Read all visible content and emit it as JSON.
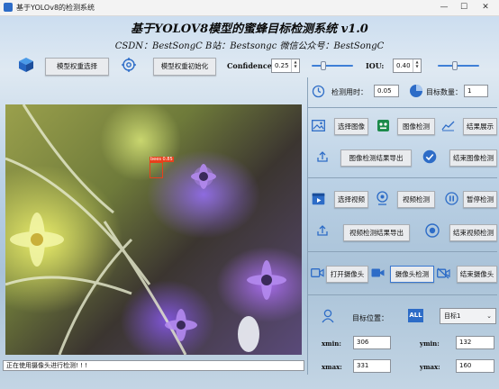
{
  "window": {
    "title": "基于YOLOv8的检测系统",
    "minimize": "—",
    "maximize": "☐",
    "close": "✕"
  },
  "header": {
    "title": "基于YOLOV8模型的蜜蜂目标检测系统 v1.0",
    "subtitle": "CSDN：BestSongC   B站：Bestsongc   微信公众号：BestSongC"
  },
  "toolbar": {
    "select_weights": "模型权重选择",
    "init_weights": "模型权重初始化",
    "confidence_label": "Confidence:",
    "confidence_value": "0.25",
    "confidence_level": 0.25,
    "iou_label": "IOU:",
    "iou_value": "0.40",
    "iou_level": 0.4
  },
  "stats": {
    "time_label": "检测用时：",
    "time_value": "0.05",
    "count_label": "目标数量：",
    "count_value": "1"
  },
  "image_section": {
    "select": "选择图像",
    "detect": "图像检测",
    "show": "结果展示",
    "export": "图像检测结果导出",
    "stop": "结束图像检测"
  },
  "video_section": {
    "select": "选择视频",
    "detect": "视频检测",
    "pause": "暂停检测",
    "export": "视频检测结果导出",
    "stop": "结束视频检测"
  },
  "camera_section": {
    "open": "打开摄像头",
    "detect": "摄像头检测",
    "close": "结束摄像头"
  },
  "target": {
    "position_label": "目标位置：",
    "all_badge": "ALL",
    "selected": "目标1",
    "xmin_label": "xmin:",
    "xmin": "306",
    "ymin_label": "ymin:",
    "ymin": "132",
    "xmax_label": "xmax:",
    "xmax": "331",
    "ymax_label": "ymax:",
    "ymax": "160"
  },
  "detection": {
    "label": "bees 0.85"
  },
  "status_bar": "正在使用摄像头进行检测! ! !",
  "colors": {
    "accent": "#2d6cc7",
    "box": "#e8401c"
  }
}
